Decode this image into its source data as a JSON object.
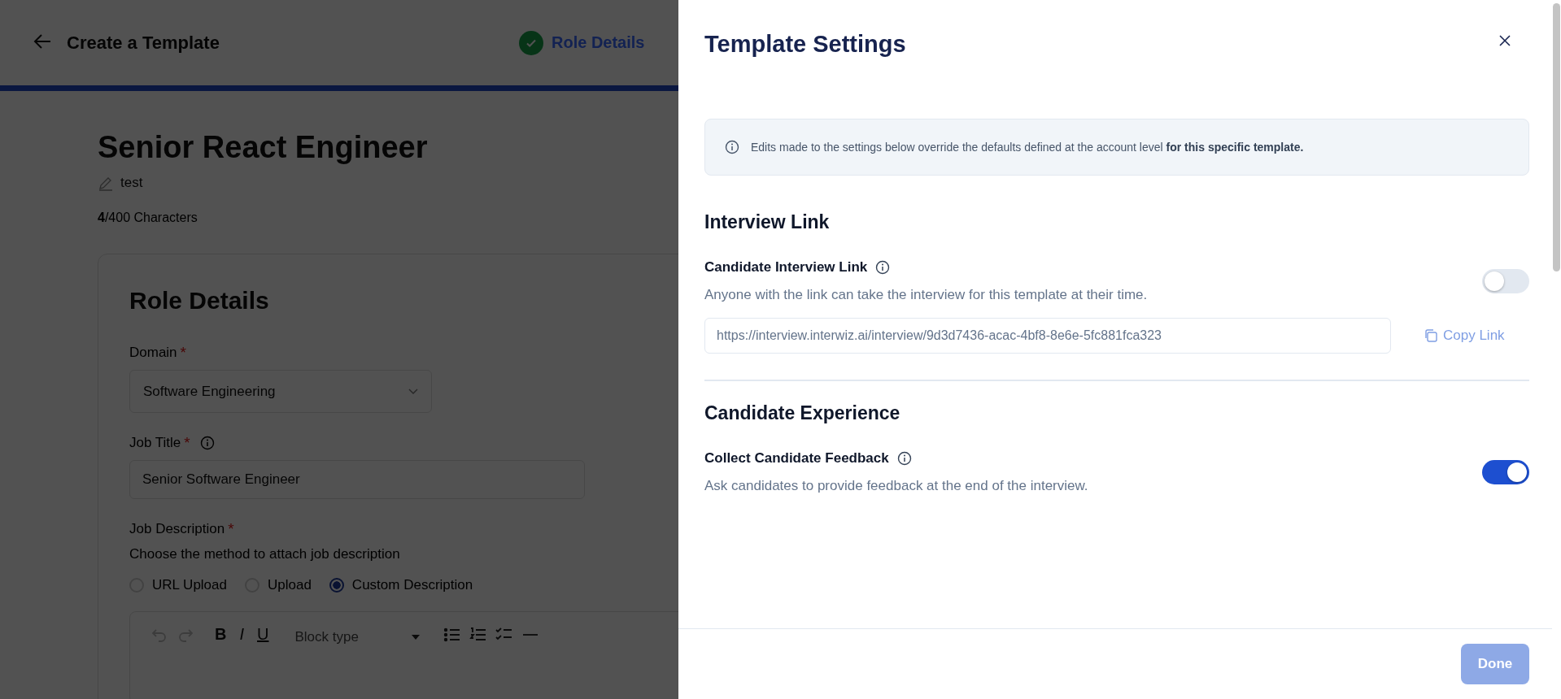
{
  "header": {
    "title": "Create a Template",
    "steps": [
      {
        "label": "Role Details",
        "completed": true
      }
    ]
  },
  "template": {
    "name": "Senior React Engineer",
    "description": "test",
    "char_count": "**4**/400 Characters"
  },
  "role_details": {
    "title": "Role Details",
    "fields": [
      {
        "kind": "select",
        "label": "Domain",
        "required_mark": "*",
        "info": false,
        "value": "Software Engineering"
      },
      {
        "kind": "text",
        "label": "Job Title",
        "required_mark": "*",
        "info": true,
        "value": "Senior Software Engineer"
      }
    ],
    "job_description": {
      "label": "Job Description",
      "required_mark": "*",
      "hint": "Choose the method to attach job description",
      "methods": [
        {
          "label": "URL Upload",
          "selected": false
        },
        {
          "label": "Upload",
          "selected": false
        },
        {
          "label": "Custom Description",
          "selected": true
        }
      ],
      "editor": {
        "bold": "B",
        "italic": "I",
        "underline": "U",
        "block_type_placeholder": "Block type"
      }
    }
  },
  "settings": {
    "title": "Template Settings",
    "notice": "Edits made to the settings below override the defaults defined at the account level **for this specific template.**",
    "sections": [
      {
        "title": "Interview Link",
        "settings": [
          {
            "label": "Candidate Interview Link",
            "info": true,
            "description": "Anyone with the link can take the interview for this template at their time.",
            "on": false,
            "link": {
              "value": "https://interview.interwiz.ai/interview/9d3d7436-acac-4bf8-8e6e-5fc881fca323",
              "copy_label": "Copy Link"
            }
          }
        ]
      },
      {
        "title": "Candidate Experience",
        "settings": [
          {
            "label": "Collect Candidate Feedback",
            "info": true,
            "description": "Ask candidates to provide feedback at the end of the interview.",
            "on": true
          }
        ]
      }
    ],
    "done": {
      "label": "Done",
      "disabled": true
    }
  }
}
